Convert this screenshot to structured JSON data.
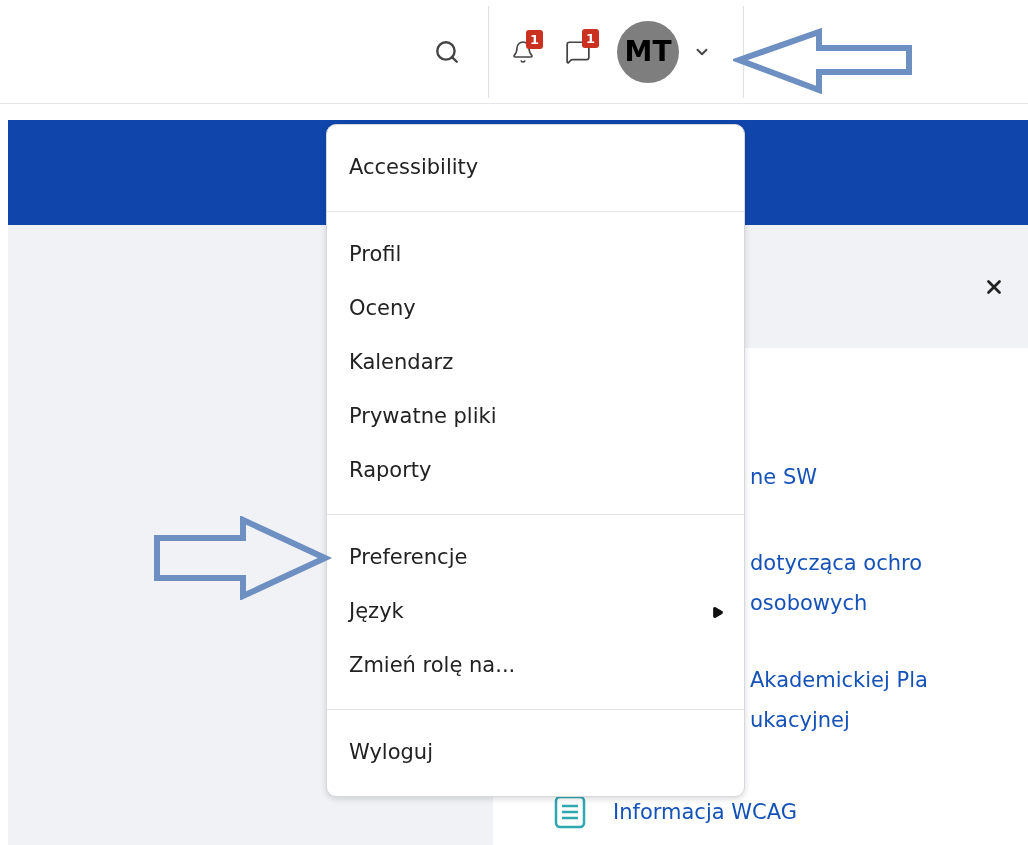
{
  "header": {
    "notifications": {
      "count": "1"
    },
    "messages": {
      "count": "1"
    },
    "user": {
      "initials": "MT"
    }
  },
  "user_menu": {
    "groups": [
      {
        "items": [
          {
            "label": "Accessibility",
            "submenu": false
          }
        ]
      },
      {
        "items": [
          {
            "label": "Profil",
            "submenu": false
          },
          {
            "label": "Oceny",
            "submenu": false
          },
          {
            "label": "Kalendarz",
            "submenu": false
          },
          {
            "label": "Prywatne pliki",
            "submenu": false
          },
          {
            "label": "Raporty",
            "submenu": false
          }
        ]
      },
      {
        "items": [
          {
            "label": "Preferencje",
            "submenu": false
          },
          {
            "label": "Język",
            "submenu": true
          },
          {
            "label": "Zmień rolę na...",
            "submenu": false
          }
        ]
      },
      {
        "items": [
          {
            "label": "Wyloguj",
            "submenu": false
          }
        ]
      }
    ]
  },
  "panel": {
    "links": [
      {
        "lines": [
          "ne SW"
        ]
      },
      {
        "lines": [
          "dotycząca ochro",
          "osobowych"
        ]
      },
      {
        "lines": [
          "Akademickiej Pla",
          "ukacyjnej"
        ]
      },
      {
        "lines": [
          "Informacja WCAG"
        ],
        "kind": "page"
      }
    ]
  }
}
